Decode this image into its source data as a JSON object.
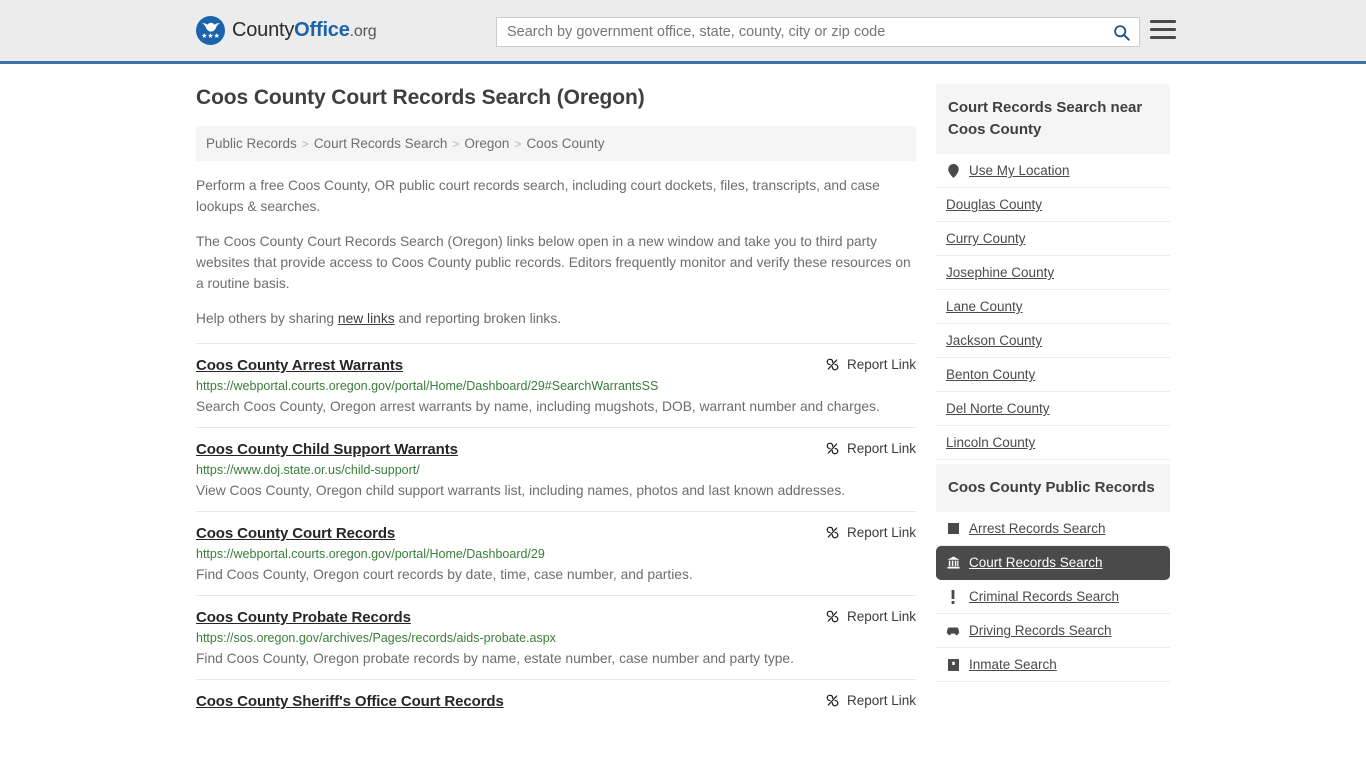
{
  "header": {
    "logo": {
      "part1": "County",
      "part2": "Office",
      "part3": ".org",
      "icon": "eagle-seal-icon",
      "stars": "★★★"
    },
    "search": {
      "placeholder": "Search by government office, state, county, city or zip code",
      "value": "",
      "button_icon": "search-icon"
    },
    "menu_icon": "hamburger-menu-icon",
    "accent_color": "#3b72a4"
  },
  "main": {
    "page_title": "Coos County Court Records Search (Oregon)",
    "breadcrumb": [
      {
        "label": "Public Records"
      },
      {
        "label": "Court Records Search"
      },
      {
        "label": "Oregon"
      },
      {
        "label": "Coos County"
      }
    ],
    "breadcrumb_separator": ">",
    "intro": {
      "p1": "Perform a free Coos County, OR public court records search, including court dockets, files, transcripts, and case lookups & searches.",
      "p2": "The Coos County Court Records Search (Oregon) links below open in a new window and take you to third party websites that provide access to Coos County public records. Editors frequently monitor and verify these resources on a routine basis.",
      "p3_before": "Help others by sharing ",
      "p3_link": "new links",
      "p3_after": " and reporting broken links."
    },
    "report_link_label": "Report Link",
    "report_link_icon": "broken-link-icon",
    "results": [
      {
        "title": "Coos County Arrest Warrants",
        "url": "https://webportal.courts.oregon.gov/portal/Home/Dashboard/29#SearchWarrantsSS",
        "description": "Search Coos County, Oregon arrest warrants by name, including mugshots, DOB, warrant number and charges."
      },
      {
        "title": "Coos County Child Support Warrants",
        "url": "https://www.doj.state.or.us/child-support/",
        "description": "View Coos County, Oregon child support warrants list, including names, photos and last known addresses."
      },
      {
        "title": "Coos County Court Records",
        "url": "https://webportal.courts.oregon.gov/portal/Home/Dashboard/29",
        "description": "Find Coos County, Oregon court records by date, time, case number, and parties."
      },
      {
        "title": "Coos County Probate Records",
        "url": "https://sos.oregon.gov/archives/Pages/records/aids-probate.aspx",
        "description": "Find Coos County, Oregon probate records by name, estate number, case number and party type."
      },
      {
        "title": "Coos County Sheriff's Office Court Records",
        "url": "",
        "description": ""
      }
    ]
  },
  "sidebar": {
    "nearby": {
      "heading": "Court Records Search near Coos County",
      "items": [
        {
          "label": "Use My Location",
          "icon": "map-pin-icon"
        },
        {
          "label": "Douglas County",
          "icon": ""
        },
        {
          "label": "Curry County",
          "icon": ""
        },
        {
          "label": "Josephine County",
          "icon": ""
        },
        {
          "label": "Lane County",
          "icon": ""
        },
        {
          "label": "Jackson County",
          "icon": ""
        },
        {
          "label": "Benton County",
          "icon": ""
        },
        {
          "label": "Del Norte County",
          "icon": ""
        },
        {
          "label": "Lincoln County",
          "icon": ""
        }
      ]
    },
    "public_records": {
      "heading": "Coos County Public Records",
      "items": [
        {
          "label": "Arrest Records Search",
          "icon": "square-icon",
          "active": false
        },
        {
          "label": "Court Records Search",
          "icon": "courthouse-icon",
          "active": true
        },
        {
          "label": "Criminal Records Search",
          "icon": "exclamation-icon",
          "active": false
        },
        {
          "label": "Driving Records Search",
          "icon": "car-icon",
          "active": false
        },
        {
          "label": "Inmate Search",
          "icon": "jail-icon",
          "active": false
        }
      ],
      "active_bg": "#4a4a4a"
    }
  }
}
